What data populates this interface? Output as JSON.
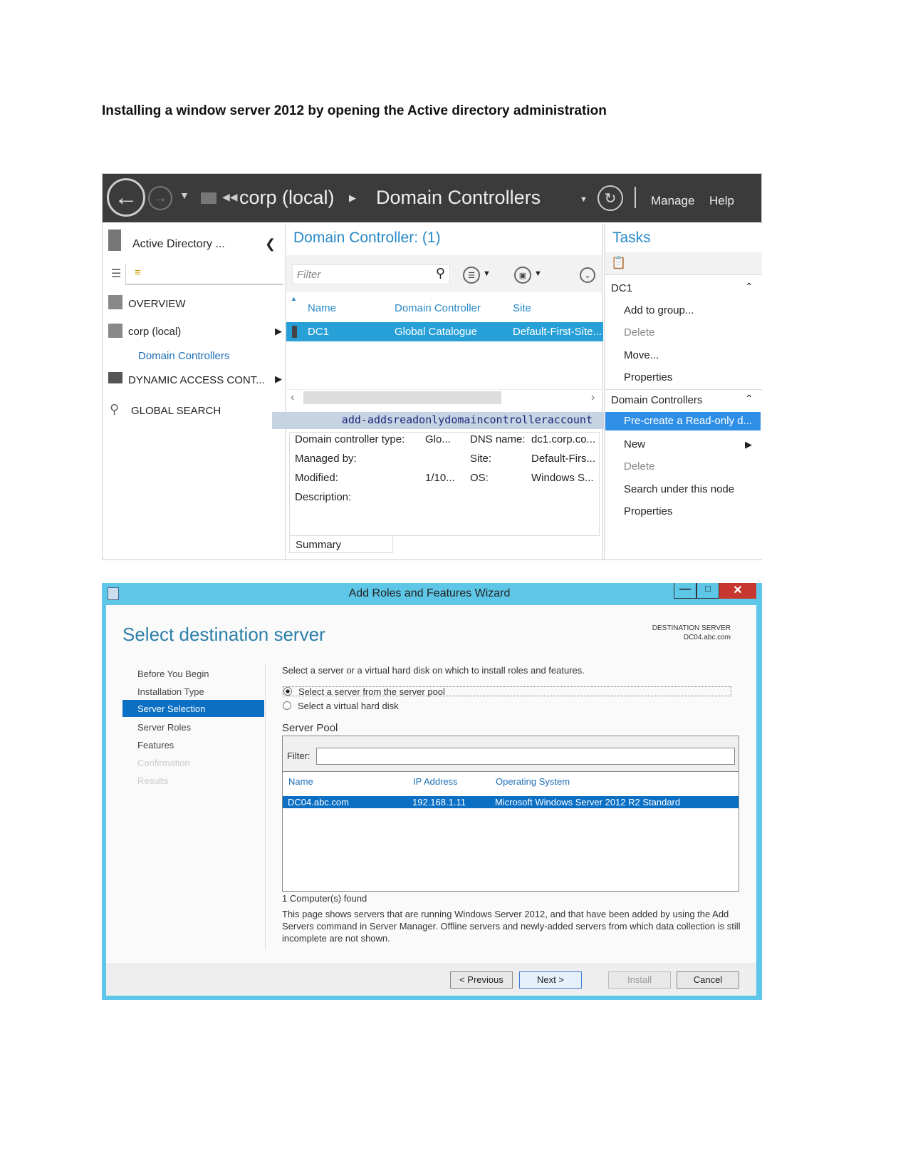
{
  "doc_title": "Installing a window server 2012 by opening the Active directory administration",
  "ad": {
    "breadcrumb": [
      "corp (local)",
      "Domain Controllers"
    ],
    "header_links": [
      "Manage",
      "Help"
    ],
    "nav_title": "Active Directory ...",
    "nav": [
      {
        "label": "OVERVIEW"
      },
      {
        "label": "corp (local)"
      },
      {
        "label": "Domain Controllers"
      },
      {
        "label": "DYNAMIC ACCESS CONT..."
      },
      {
        "label": "GLOBAL SEARCH"
      }
    ],
    "list_title": "Domain Controller: (1)",
    "filter_placeholder": "Filter",
    "columns": [
      "Name",
      "Domain Controller",
      "Site"
    ],
    "rows": [
      [
        "DC1",
        "Global Catalogue",
        "Default-First-Site..."
      ]
    ],
    "command": "add-addsreadonlydomaincontrolleraccount",
    "details": [
      [
        "Domain controller type:",
        "Glo...",
        "DNS name:",
        "dc1.corp.co..."
      ],
      [
        "Managed by:",
        "",
        "Site:",
        "Default-Firs..."
      ],
      [
        "Modified:",
        "1/10...",
        "OS:",
        "Windows S..."
      ],
      [
        "Description:",
        "",
        "",
        ""
      ]
    ],
    "summary_tab": "Summary",
    "tasks_title": "Tasks",
    "section1": "DC1",
    "section1_items": [
      {
        "label": "Add to group...",
        "disabled": false
      },
      {
        "label": "Delete",
        "disabled": true
      },
      {
        "label": "Move...",
        "disabled": false
      },
      {
        "label": "Properties",
        "disabled": false
      }
    ],
    "section2": "Domain Controllers",
    "section2_items": [
      {
        "label": "Pre-create a Read-only d...",
        "selected": true
      },
      {
        "label": "New"
      },
      {
        "label": "Delete",
        "disabled": true
      },
      {
        "label": "Search under this node"
      },
      {
        "label": "Properties"
      }
    ]
  },
  "wizard": {
    "title": "Add Roles and Features Wizard",
    "heading": "Select destination server",
    "dest_label": "DESTINATION SERVER",
    "dest_value": "DC04.abc.com",
    "steps": [
      {
        "label": "Before You Begin"
      },
      {
        "label": "Installation Type"
      },
      {
        "label": "Server Selection",
        "active": true
      },
      {
        "label": "Server Roles"
      },
      {
        "label": "Features"
      },
      {
        "label": "Confirmation",
        "disabled": true
      },
      {
        "label": "Results",
        "disabled": true
      }
    ],
    "instruction": "Select a server or a virtual hard disk on which to install roles and features.",
    "option1": "Select a server from the server pool",
    "option2": "Select a virtual hard disk",
    "selected_option": 1,
    "pool_label": "Server Pool",
    "filter_label": "Filter:",
    "filter_value": "",
    "columns": [
      "Name",
      "IP Address",
      "Operating System"
    ],
    "rows": [
      [
        "DC04.abc.com",
        "192.168.1.11",
        "Microsoft Windows Server 2012 R2 Standard"
      ]
    ],
    "found": "1 Computer(s) found",
    "note": "This page shows servers that are running Windows Server 2012, and that have been added by using the Add Servers command in Server Manager. Offline servers and newly-added servers from which data collection is still incomplete are not shown.",
    "buttons": {
      "previous": "< Previous",
      "next": "Next >",
      "install": "Install",
      "cancel": "Cancel"
    }
  },
  "colors": {
    "header": "#3b3b3b",
    "accent": "#27a0d8",
    "wizard_frame": "#5ec6e6",
    "selection": "#0b6fc4"
  }
}
